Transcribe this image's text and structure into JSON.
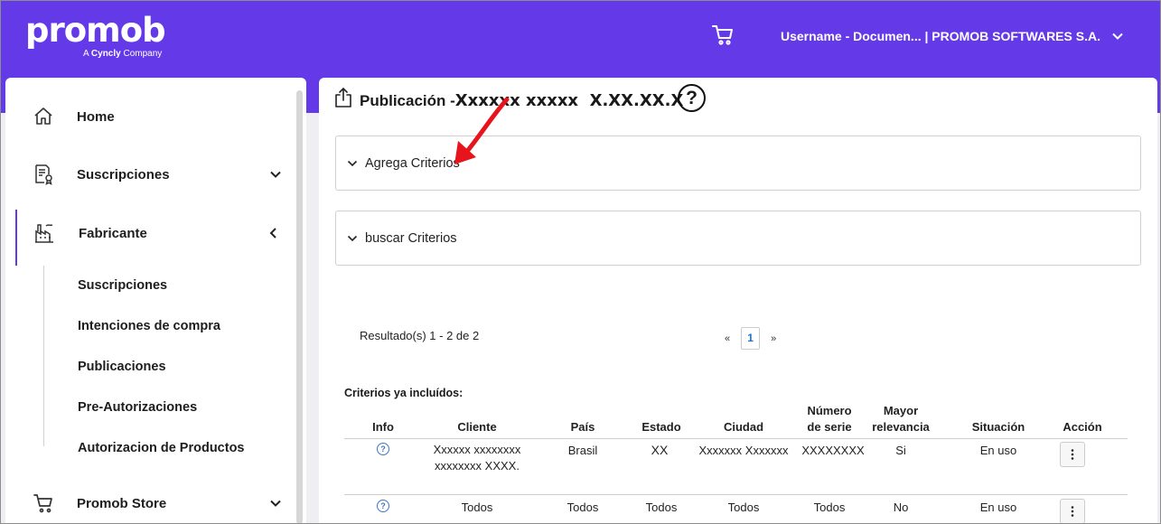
{
  "header": {
    "logo_text": "promob",
    "logo_sub_prefix": "A ",
    "logo_sub_brand": "Cyncly",
    "logo_sub_suffix": " Company",
    "cart_icon": "cart-icon",
    "user_label": "Username - Documen... | PROMOB SOFTWARES S.A."
  },
  "sidebar": {
    "items": [
      {
        "label": "Home",
        "icon": "home-icon"
      },
      {
        "label": "Suscripciones",
        "icon": "subscription-document-icon"
      },
      {
        "label": "Fabricante",
        "icon": "factory-icon"
      },
      {
        "label": "Promob Store",
        "icon": "cart-icon"
      }
    ],
    "sub_items": [
      {
        "label": "Suscripciones"
      },
      {
        "label": "Intenciones de compra"
      },
      {
        "label": "Publicaciones"
      },
      {
        "label": "Pre-Autorizaciones"
      },
      {
        "label": "Autorizacion de Productos"
      }
    ]
  },
  "main": {
    "title_prefix": "Publicación -",
    "title_value": "Xxxxxx xxxxx  X.XX.XX.X",
    "help_symbol": "?",
    "accordions": [
      {
        "label": "Agrega Criterios"
      },
      {
        "label": "buscar Criterios"
      }
    ],
    "results_text": "Resultado(s) 1 - 2 de 2",
    "pager": {
      "prev": "«",
      "current": "1",
      "next": "»"
    },
    "criteria_title": "Criterios ya incluídos:",
    "table": {
      "headers": {
        "info": "Info",
        "cliente": "Cliente",
        "pais": "País",
        "estado": "Estado",
        "ciudad": "Ciudad",
        "numero_line1": "Número",
        "numero_line2": "de serie",
        "mayor_line1": "Mayor",
        "mayor_line2": "relevancia",
        "situacion": "Situación",
        "accion": "Acción"
      },
      "rows": [
        {
          "info": "?",
          "cliente_line1": "Xxxxxx xxxxxxxx",
          "cliente_line2": "xxxxxxxx XXXX.",
          "pais": "Brasil",
          "estado": "XX",
          "ciudad": "Xxxxxxx Xxxxxxx",
          "numero_serie": "XXXXXXXX",
          "mayor_relevancia": "Si",
          "situacion": "En uso"
        },
        {
          "info": "?",
          "cliente_line1": "Todos",
          "cliente_line2": "",
          "pais": "Todos",
          "estado": "Todos",
          "ciudad": "Todos",
          "numero_serie": "Todos",
          "mayor_relevancia": "No",
          "situacion": "En uso"
        }
      ]
    }
  }
}
